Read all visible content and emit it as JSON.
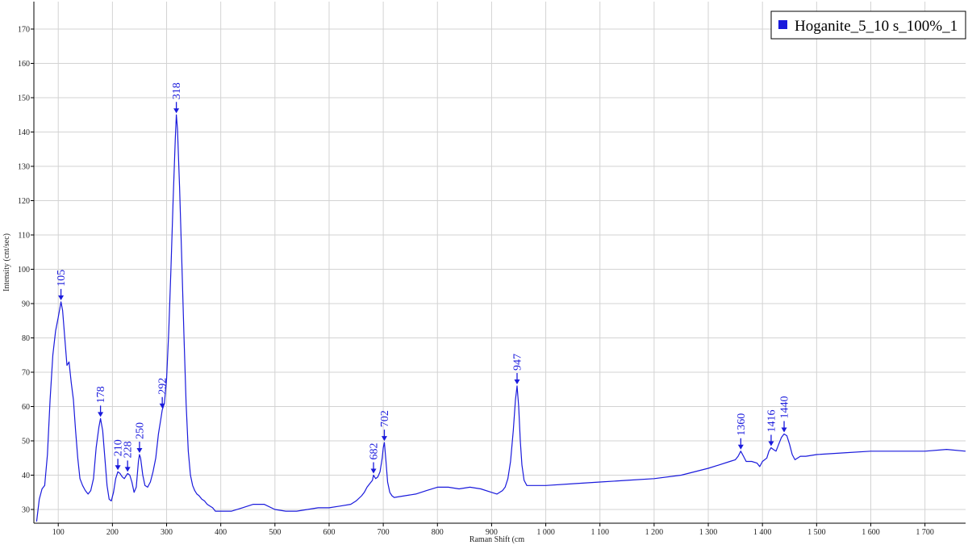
{
  "chart_data": {
    "type": "line",
    "xlabel": "Raman Shift (cm",
    "ylabel": "Intensity (cnt/sec)",
    "xlim": [
      55,
      1775
    ],
    "ylim": [
      26,
      178
    ],
    "x_ticks": [
      {
        "value": 100,
        "label": "100"
      },
      {
        "value": 200,
        "label": "200"
      },
      {
        "value": 300,
        "label": "300"
      },
      {
        "value": 400,
        "label": "400"
      },
      {
        "value": 500,
        "label": "500"
      },
      {
        "value": 600,
        "label": "600"
      },
      {
        "value": 700,
        "label": "700"
      },
      {
        "value": 800,
        "label": "800"
      },
      {
        "value": 900,
        "label": "900"
      },
      {
        "value": 1000,
        "label": "1 000"
      },
      {
        "value": 1100,
        "label": "1 100"
      },
      {
        "value": 1200,
        "label": "1 200"
      },
      {
        "value": 1300,
        "label": "1 300"
      },
      {
        "value": 1400,
        "label": "1 400"
      },
      {
        "value": 1500,
        "label": "1 500"
      },
      {
        "value": 1600,
        "label": "1 600"
      },
      {
        "value": 1700,
        "label": "1 700"
      }
    ],
    "y_ticks": [
      30,
      40,
      50,
      60,
      70,
      80,
      90,
      100,
      110,
      120,
      130,
      140,
      150,
      160,
      170
    ],
    "grid": true,
    "legend_position": "top-right",
    "series": [
      {
        "name": "Hoganite_5_10 s_100%_1",
        "color": "#1a1adc",
        "points": [
          [
            60,
            26.5
          ],
          [
            65,
            33
          ],
          [
            70,
            36
          ],
          [
            75,
            37
          ],
          [
            80,
            46
          ],
          [
            85,
            62
          ],
          [
            90,
            75
          ],
          [
            95,
            82
          ],
          [
            100,
            86
          ],
          [
            105,
            90.5
          ],
          [
            108,
            88
          ],
          [
            112,
            80
          ],
          [
            116,
            72
          ],
          [
            120,
            73
          ],
          [
            124,
            67
          ],
          [
            128,
            62
          ],
          [
            132,
            53
          ],
          [
            136,
            45
          ],
          [
            140,
            39
          ],
          [
            145,
            37
          ],
          [
            150,
            35.5
          ],
          [
            155,
            34.5
          ],
          [
            160,
            35.5
          ],
          [
            165,
            39
          ],
          [
            170,
            48
          ],
          [
            175,
            54
          ],
          [
            178,
            56.5
          ],
          [
            182,
            53
          ],
          [
            186,
            45
          ],
          [
            190,
            37
          ],
          [
            194,
            33
          ],
          [
            198,
            32.5
          ],
          [
            202,
            35
          ],
          [
            206,
            39
          ],
          [
            210,
            41
          ],
          [
            214,
            40.5
          ],
          [
            218,
            39.5
          ],
          [
            222,
            39
          ],
          [
            226,
            40
          ],
          [
            228,
            40.5
          ],
          [
            232,
            40
          ],
          [
            236,
            38
          ],
          [
            240,
            35
          ],
          [
            244,
            36.5
          ],
          [
            248,
            44
          ],
          [
            250,
            46
          ],
          [
            252,
            45
          ],
          [
            256,
            40
          ],
          [
            260,
            37
          ],
          [
            265,
            36.5
          ],
          [
            270,
            38
          ],
          [
            275,
            41
          ],
          [
            280,
            45
          ],
          [
            285,
            52
          ],
          [
            290,
            57
          ],
          [
            292,
            59
          ],
          [
            296,
            61
          ],
          [
            300,
            68
          ],
          [
            304,
            82
          ],
          [
            308,
            100
          ],
          [
            312,
            120
          ],
          [
            316,
            138
          ],
          [
            318,
            145
          ],
          [
            320,
            141
          ],
          [
            324,
            124
          ],
          [
            328,
            103
          ],
          [
            332,
            81
          ],
          [
            336,
            61
          ],
          [
            340,
            47
          ],
          [
            344,
            40
          ],
          [
            348,
            37
          ],
          [
            352,
            35.5
          ],
          [
            356,
            34.5
          ],
          [
            360,
            34
          ],
          [
            365,
            33
          ],
          [
            370,
            32.5
          ],
          [
            375,
            31.5
          ],
          [
            380,
            31
          ],
          [
            385,
            30.5
          ],
          [
            390,
            29.5
          ],
          [
            400,
            29.5
          ],
          [
            420,
            29.5
          ],
          [
            440,
            30.5
          ],
          [
            460,
            31.5
          ],
          [
            480,
            31.5
          ],
          [
            500,
            30
          ],
          [
            520,
            29.5
          ],
          [
            540,
            29.5
          ],
          [
            560,
            30
          ],
          [
            580,
            30.5
          ],
          [
            600,
            30.5
          ],
          [
            620,
            31
          ],
          [
            640,
            31.5
          ],
          [
            650,
            32.5
          ],
          [
            660,
            34
          ],
          [
            665,
            35
          ],
          [
            670,
            36.5
          ],
          [
            675,
            37.5
          ],
          [
            680,
            38.5
          ],
          [
            682,
            40
          ],
          [
            686,
            39
          ],
          [
            690,
            39.5
          ],
          [
            694,
            41
          ],
          [
            698,
            45
          ],
          [
            700,
            48
          ],
          [
            702,
            49.5
          ],
          [
            705,
            44
          ],
          [
            708,
            38
          ],
          [
            712,
            35
          ],
          [
            716,
            34
          ],
          [
            720,
            33.5
          ],
          [
            740,
            34
          ],
          [
            760,
            34.5
          ],
          [
            780,
            35.5
          ],
          [
            800,
            36.5
          ],
          [
            820,
            36.5
          ],
          [
            840,
            36
          ],
          [
            860,
            36.5
          ],
          [
            880,
            36
          ],
          [
            900,
            35
          ],
          [
            910,
            34.5
          ],
          [
            920,
            35.5
          ],
          [
            925,
            36.5
          ],
          [
            930,
            39
          ],
          [
            935,
            44
          ],
          [
            940,
            53
          ],
          [
            944,
            62
          ],
          [
            947,
            66
          ],
          [
            950,
            60
          ],
          [
            953,
            50
          ],
          [
            956,
            43
          ],
          [
            960,
            38.5
          ],
          [
            965,
            37
          ],
          [
            970,
            37
          ],
          [
            980,
            37
          ],
          [
            1000,
            37
          ],
          [
            1050,
            37.5
          ],
          [
            1100,
            38
          ],
          [
            1150,
            38.5
          ],
          [
            1200,
            39
          ],
          [
            1250,
            40
          ],
          [
            1300,
            42
          ],
          [
            1320,
            43
          ],
          [
            1340,
            44
          ],
          [
            1350,
            44.5
          ],
          [
            1355,
            45.5
          ],
          [
            1360,
            47
          ],
          [
            1365,
            45.5
          ],
          [
            1370,
            44
          ],
          [
            1380,
            44
          ],
          [
            1390,
            43.5
          ],
          [
            1395,
            42.5
          ],
          [
            1400,
            44
          ],
          [
            1408,
            45
          ],
          [
            1412,
            47
          ],
          [
            1416,
            48
          ],
          [
            1420,
            47.5
          ],
          [
            1425,
            47
          ],
          [
            1430,
            49
          ],
          [
            1435,
            51
          ],
          [
            1440,
            52
          ],
          [
            1445,
            51.5
          ],
          [
            1450,
            49
          ],
          [
            1455,
            46
          ],
          [
            1460,
            44.5
          ],
          [
            1470,
            45.5
          ],
          [
            1480,
            45.5
          ],
          [
            1500,
            46
          ],
          [
            1550,
            46.5
          ],
          [
            1600,
            47
          ],
          [
            1650,
            47
          ],
          [
            1700,
            47
          ],
          [
            1740,
            47.5
          ],
          [
            1775,
            47
          ]
        ]
      }
    ],
    "annotations": [
      {
        "x": 105,
        "y": 90.5,
        "label": "105"
      },
      {
        "x": 178,
        "y": 56.5,
        "label": "178"
      },
      {
        "x": 210,
        "y": 41,
        "label": "210"
      },
      {
        "x": 228,
        "y": 40.5,
        "label": "228"
      },
      {
        "x": 250,
        "y": 46,
        "label": "250"
      },
      {
        "x": 292,
        "y": 59,
        "label": "292"
      },
      {
        "x": 318,
        "y": 145,
        "label": "318"
      },
      {
        "x": 682,
        "y": 40,
        "label": "682"
      },
      {
        "x": 702,
        "y": 49.5,
        "label": "702"
      },
      {
        "x": 947,
        "y": 66,
        "label": "947"
      },
      {
        "x": 1360,
        "y": 47,
        "label": "1360"
      },
      {
        "x": 1416,
        "y": 48,
        "label": "1416"
      },
      {
        "x": 1440,
        "y": 52,
        "label": "1440"
      }
    ]
  }
}
